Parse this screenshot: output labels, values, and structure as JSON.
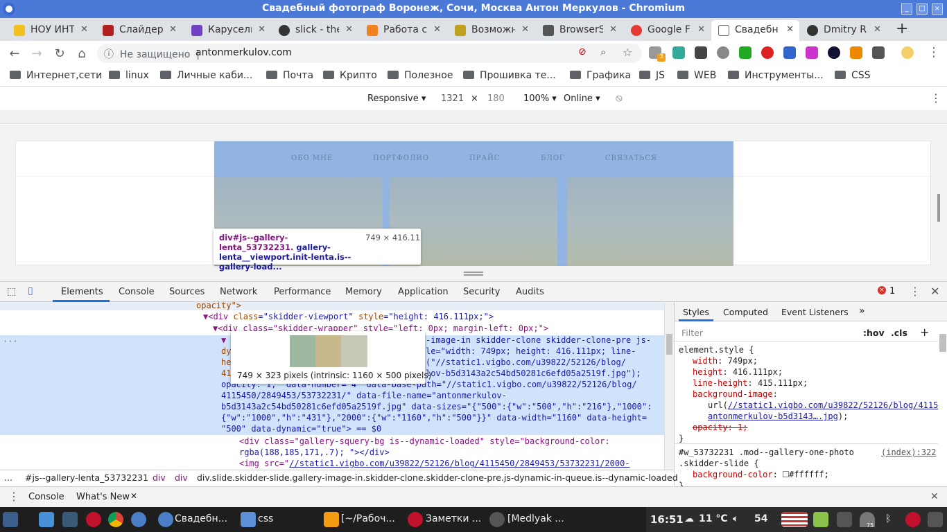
{
  "window": {
    "title": "Свадебный фотограф Воронеж, Сочи, Москва Антон Меркулов - Chromium"
  },
  "tabs": [
    {
      "label": "НОУ ИНТ",
      "icon": "intuit-icon",
      "color": "#f0c020"
    },
    {
      "label": "Слайдер",
      "icon": "cube-icon",
      "color": "#b02020"
    },
    {
      "label": "Карусель",
      "icon": "bootstrap-icon",
      "color": "#6f42c1"
    },
    {
      "label": "slick - the",
      "icon": "github-icon",
      "color": "#333333"
    },
    {
      "label": "Работа с",
      "icon": "hexagon-icon",
      "color": "#f08020"
    },
    {
      "label": "Возможн",
      "icon": "css-icon",
      "color": "#c0a020"
    },
    {
      "label": "BrowserS",
      "icon": "shield-icon",
      "color": "#555555"
    },
    {
      "label": "Google F",
      "icon": "f-icon",
      "color": "#e53935"
    },
    {
      "label": "Свадебн",
      "icon": "am-logo-icon",
      "color": "#666666"
    },
    {
      "label": "Dmitry R",
      "icon": "github-icon",
      "color": "#333333"
    }
  ],
  "toolbar": {
    "insecure": "Не защищено",
    "url": "antonmerkulov.com",
    "ext_badge": "3"
  },
  "bookmarks": [
    "Интернет,сети",
    "linux",
    "Личные каби...",
    "Почта",
    "Крипто",
    "Полезное",
    "Прошивка те...",
    "Графика",
    "JS",
    "WEB",
    "Инструменты...",
    "CSS"
  ],
  "device": {
    "mode": "Responsive",
    "width": "1321",
    "height": "180",
    "x": "×",
    "zoom": "100%",
    "network": "Online"
  },
  "site": {
    "nav": [
      "ОБО МНЕ",
      "ПОРТФОЛИО",
      "ПРАЙС",
      "БЛОГ",
      "СВЯЗАТЬСЯ"
    ]
  },
  "highlight": {
    "tag": "div#js--gallery-lenta_53732231.",
    "rest": "gallery-lenta__viewport.init-lenta.is--gallery-load...",
    "size": "749 × 416.11"
  },
  "devtools": {
    "tabs": [
      "Elements",
      "Console",
      "Sources",
      "Network",
      "Performance",
      "Memory",
      "Application",
      "Security",
      "Audits"
    ],
    "errors": "1",
    "elements": {
      "l0": "opacity\">",
      "l1a": "<div ",
      "l1b": "class",
      "l1c": "=\"skidder-viewport\" ",
      "l1d": "style",
      "l1e": "=\"height: 416.111px;\">",
      "l2": "<div class=\"skidder-wrapper\" style=\"left: 0px; margin-left: 0px;\">",
      "l3": "▼",
      "s1": "-image-in skidder-clone skidder-clone-pre js-",
      "s2a": "dy",
      "s2b": "le=\"width: 749px; height: 416.111px; line-",
      "s3a": "he",
      "s3b": "(\"//static1.vigbo.com/u39822/52126/blog/",
      "s4a": "41",
      "s4b": "lov-b5d3143a2c54bd50281c6efd05a2519f.jpg\");",
      "s5": "opacity: 1;\" data-number=\"4\" data-base-path=\"//static1.vigbo.com/u39822/52126/blog/",
      "s6": "4115450/2849453/53732231/\" data-file-name=\"antonmerkulov-",
      "s7": "b5d3143a2c54bd50281c6efd05a2519f.jpg\" data-sizes=\"{\"500\":{\"w\":\"500\",\"h\":\"216\"},\"1000\":",
      "s8": "{\"w\":\"1000\",\"h\":\"431\"},\"2000\":{\"w\":\"1160\",\"h\":\"500\"}}\" data-width=\"1160\" data-height=",
      "s9": "\"500\" data-dynamic=\"true\"> == $0",
      "l10": "<div class=\"gallery-squery-bg is--dynamic-loaded\" style=\"background-color:",
      "l11": "rgba(188,185,171,.7); \"></div>",
      "l12a": "<img src=\"",
      "l12b": "//static1.vigbo.com/u39822/52126/blog/4115450/2849453/53732231/2000-"
    },
    "imgtip": "749 × 323 pixels (intrinsic: 1160 × 500 pixels)",
    "styles_tabs": [
      "Styles",
      "Computed",
      "Event Listeners"
    ],
    "filter": "Filter",
    "hov": ":hov",
    "cls": ".cls",
    "styles": {
      "sel1": "element.style {",
      "p1": "width",
      "v1": "749px;",
      "p2": "height",
      "v2": "416.111px;",
      "p3": "line-height",
      "v3": "415.111px;",
      "p4": "background-image",
      "v4a": "url(",
      "v4b": "//static1.vigbo.com/u39822/52126/blog/4115",
      "v4c": "antonmerkulov-b5d3143….jpg",
      "v4d": ");",
      "p5": "opacity: 1;",
      "close1": "}",
      "sel2": "#w_53732231 .mod--gallery-one-photo",
      "sel2b": ".skidder-slide {",
      "src": "(index):322",
      "p6": "background-color",
      "v6": "#ffffff;",
      "close2": "}"
    },
    "crumbs": [
      "#js--gallery-lenta_53732231",
      "div",
      "div",
      "div.slide.skidder-slide.gallery-image-in.skidder-clone.skidder-clone-pre.js-dynamic-in-queue.is--dynamic-loaded"
    ],
    "drawer": [
      "Console",
      "What's New"
    ]
  },
  "taskbar": {
    "items": [
      "Свадебн...",
      "css",
      "[~/Рабоч...",
      "Заметки ...",
      "[Medlyak ..."
    ],
    "time": "16:51",
    "temp": "11 °C",
    "volume": "54",
    "battery": "75"
  }
}
